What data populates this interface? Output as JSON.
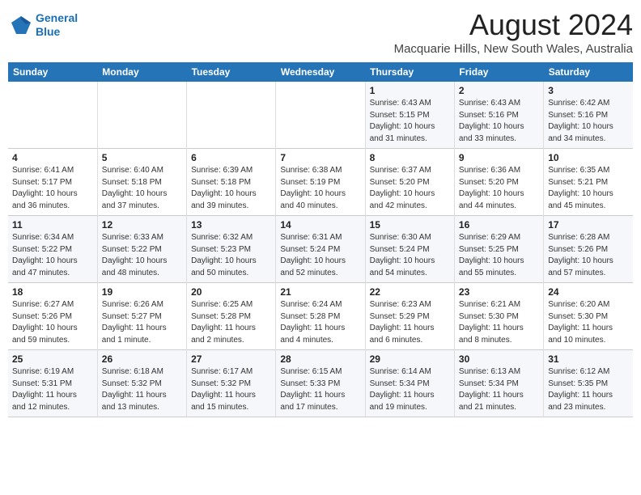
{
  "header": {
    "logo_line1": "General",
    "logo_line2": "Blue",
    "month_title": "August 2024",
    "location": "Macquarie Hills, New South Wales, Australia"
  },
  "weekdays": [
    "Sunday",
    "Monday",
    "Tuesday",
    "Wednesday",
    "Thursday",
    "Friday",
    "Saturday"
  ],
  "rows": [
    [
      {
        "day": "",
        "detail": ""
      },
      {
        "day": "",
        "detail": ""
      },
      {
        "day": "",
        "detail": ""
      },
      {
        "day": "",
        "detail": ""
      },
      {
        "day": "1",
        "detail": "Sunrise: 6:43 AM\nSunset: 5:15 PM\nDaylight: 10 hours\nand 31 minutes."
      },
      {
        "day": "2",
        "detail": "Sunrise: 6:43 AM\nSunset: 5:16 PM\nDaylight: 10 hours\nand 33 minutes."
      },
      {
        "day": "3",
        "detail": "Sunrise: 6:42 AM\nSunset: 5:16 PM\nDaylight: 10 hours\nand 34 minutes."
      }
    ],
    [
      {
        "day": "4",
        "detail": "Sunrise: 6:41 AM\nSunset: 5:17 PM\nDaylight: 10 hours\nand 36 minutes."
      },
      {
        "day": "5",
        "detail": "Sunrise: 6:40 AM\nSunset: 5:18 PM\nDaylight: 10 hours\nand 37 minutes."
      },
      {
        "day": "6",
        "detail": "Sunrise: 6:39 AM\nSunset: 5:18 PM\nDaylight: 10 hours\nand 39 minutes."
      },
      {
        "day": "7",
        "detail": "Sunrise: 6:38 AM\nSunset: 5:19 PM\nDaylight: 10 hours\nand 40 minutes."
      },
      {
        "day": "8",
        "detail": "Sunrise: 6:37 AM\nSunset: 5:20 PM\nDaylight: 10 hours\nand 42 minutes."
      },
      {
        "day": "9",
        "detail": "Sunrise: 6:36 AM\nSunset: 5:20 PM\nDaylight: 10 hours\nand 44 minutes."
      },
      {
        "day": "10",
        "detail": "Sunrise: 6:35 AM\nSunset: 5:21 PM\nDaylight: 10 hours\nand 45 minutes."
      }
    ],
    [
      {
        "day": "11",
        "detail": "Sunrise: 6:34 AM\nSunset: 5:22 PM\nDaylight: 10 hours\nand 47 minutes."
      },
      {
        "day": "12",
        "detail": "Sunrise: 6:33 AM\nSunset: 5:22 PM\nDaylight: 10 hours\nand 48 minutes."
      },
      {
        "day": "13",
        "detail": "Sunrise: 6:32 AM\nSunset: 5:23 PM\nDaylight: 10 hours\nand 50 minutes."
      },
      {
        "day": "14",
        "detail": "Sunrise: 6:31 AM\nSunset: 5:24 PM\nDaylight: 10 hours\nand 52 minutes."
      },
      {
        "day": "15",
        "detail": "Sunrise: 6:30 AM\nSunset: 5:24 PM\nDaylight: 10 hours\nand 54 minutes."
      },
      {
        "day": "16",
        "detail": "Sunrise: 6:29 AM\nSunset: 5:25 PM\nDaylight: 10 hours\nand 55 minutes."
      },
      {
        "day": "17",
        "detail": "Sunrise: 6:28 AM\nSunset: 5:26 PM\nDaylight: 10 hours\nand 57 minutes."
      }
    ],
    [
      {
        "day": "18",
        "detail": "Sunrise: 6:27 AM\nSunset: 5:26 PM\nDaylight: 10 hours\nand 59 minutes."
      },
      {
        "day": "19",
        "detail": "Sunrise: 6:26 AM\nSunset: 5:27 PM\nDaylight: 11 hours\nand 1 minute."
      },
      {
        "day": "20",
        "detail": "Sunrise: 6:25 AM\nSunset: 5:28 PM\nDaylight: 11 hours\nand 2 minutes."
      },
      {
        "day": "21",
        "detail": "Sunrise: 6:24 AM\nSunset: 5:28 PM\nDaylight: 11 hours\nand 4 minutes."
      },
      {
        "day": "22",
        "detail": "Sunrise: 6:23 AM\nSunset: 5:29 PM\nDaylight: 11 hours\nand 6 minutes."
      },
      {
        "day": "23",
        "detail": "Sunrise: 6:21 AM\nSunset: 5:30 PM\nDaylight: 11 hours\nand 8 minutes."
      },
      {
        "day": "24",
        "detail": "Sunrise: 6:20 AM\nSunset: 5:30 PM\nDaylight: 11 hours\nand 10 minutes."
      }
    ],
    [
      {
        "day": "25",
        "detail": "Sunrise: 6:19 AM\nSunset: 5:31 PM\nDaylight: 11 hours\nand 12 minutes."
      },
      {
        "day": "26",
        "detail": "Sunrise: 6:18 AM\nSunset: 5:32 PM\nDaylight: 11 hours\nand 13 minutes."
      },
      {
        "day": "27",
        "detail": "Sunrise: 6:17 AM\nSunset: 5:32 PM\nDaylight: 11 hours\nand 15 minutes."
      },
      {
        "day": "28",
        "detail": "Sunrise: 6:15 AM\nSunset: 5:33 PM\nDaylight: 11 hours\nand 17 minutes."
      },
      {
        "day": "29",
        "detail": "Sunrise: 6:14 AM\nSunset: 5:34 PM\nDaylight: 11 hours\nand 19 minutes."
      },
      {
        "day": "30",
        "detail": "Sunrise: 6:13 AM\nSunset: 5:34 PM\nDaylight: 11 hours\nand 21 minutes."
      },
      {
        "day": "31",
        "detail": "Sunrise: 6:12 AM\nSunset: 5:35 PM\nDaylight: 11 hours\nand 23 minutes."
      }
    ]
  ]
}
